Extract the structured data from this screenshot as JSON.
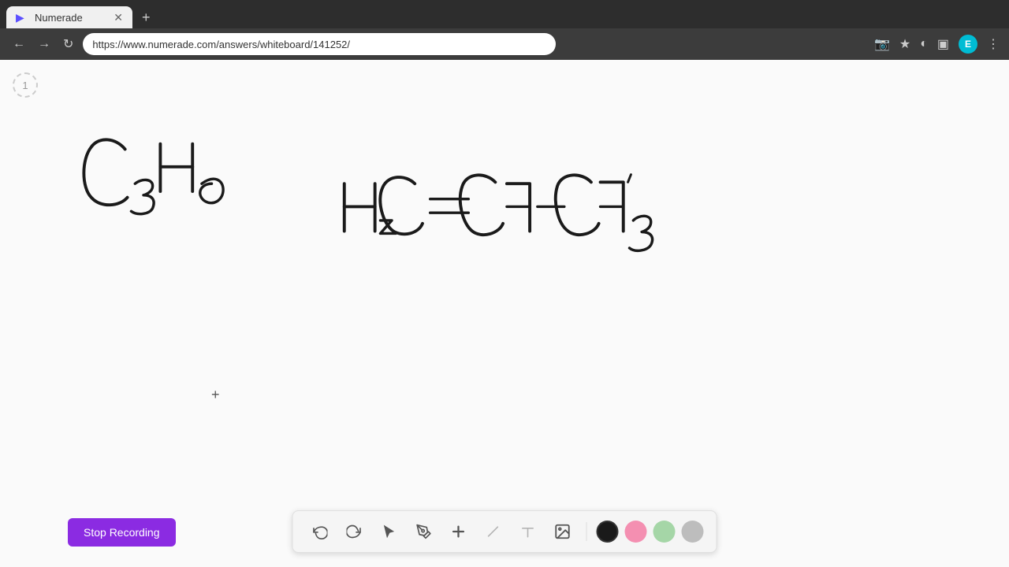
{
  "browser": {
    "tab_title": "Numerade",
    "tab_favicon": "▶",
    "url": "https://www.numerade.com/answers/whiteboard/141252/",
    "user_avatar_letter": "E"
  },
  "page": {
    "page_number": "1"
  },
  "formulas": {
    "formula1": "C₃H₆",
    "formula2": "H₂C=CH-CH₃"
  },
  "toolbar": {
    "undo_label": "↺",
    "redo_label": "↻",
    "select_label": "▲",
    "pen_label": "✏",
    "add_label": "+",
    "eraser_label": "/",
    "text_label": "T",
    "image_label": "🖼",
    "colors": [
      "black",
      "pink",
      "mint",
      "gray"
    ],
    "color_values": [
      "#1a1a1a",
      "#f48fb1",
      "#a5d6a7",
      "#bdbdbd"
    ]
  },
  "stop_recording": {
    "label": "Stop Recording"
  }
}
